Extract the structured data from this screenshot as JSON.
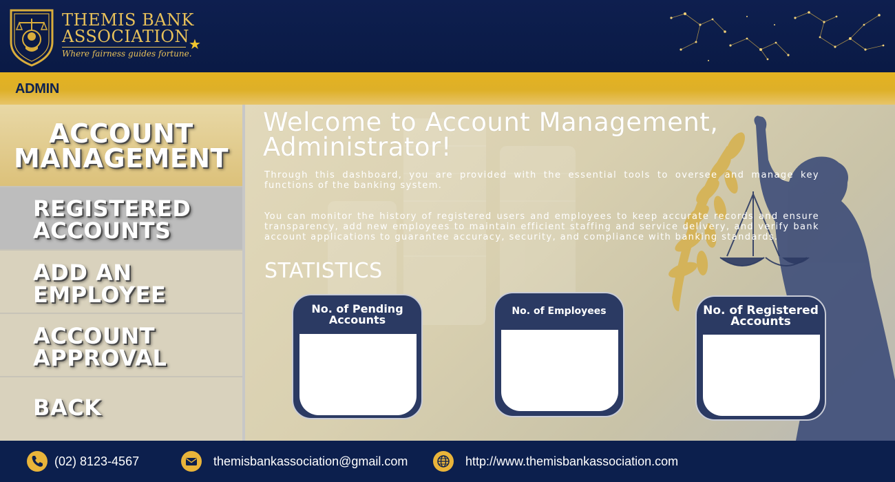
{
  "header": {
    "brand_line1": "THEMIS BANK",
    "brand_line2": "ASSOCIATION",
    "tagline": "Where fairness guides fortune."
  },
  "admin_bar": {
    "label": "ADMIN"
  },
  "sidebar": {
    "items": [
      {
        "label": "ACCOUNT\nMANAGEMENT",
        "active": true
      },
      {
        "label": "REGISTERED\nACCOUNTS"
      },
      {
        "label": "ADD AN\nEMPLOYEE"
      },
      {
        "label": "ACCOUNT\nAPPROVAL"
      },
      {
        "label": "BACK"
      }
    ]
  },
  "main": {
    "title": "Welcome to Account Management, Administrator!",
    "intro_1": "Through this dashboard, you are provided with the essential tools to oversee and manage key functions of the banking system.",
    "intro_2": "You can monitor the history of registered users and employees to keep accurate records and ensure transparency, add new employees to maintain efficient staffing and service delivery, and verify bank account applications to guarantee accuracy, security, and compliance with banking standards.",
    "stats_heading": "STATISTICS",
    "stats": [
      {
        "title": "No. of Pending Accounts",
        "value": ""
      },
      {
        "title": "No. of Employees",
        "value": ""
      },
      {
        "title": "No. of Registered Accounts",
        "value": ""
      }
    ]
  },
  "footer": {
    "phone": "(02) 8123-4567",
    "email": "themisbankassociation@gmail.com",
    "website": "http://www.themisbankassociation.com"
  },
  "colors": {
    "navy": "#0e1f4f",
    "gold": "#e4b221",
    "card": "#2b3a63"
  },
  "icons": [
    "justice-badge-icon",
    "star-icon",
    "constellation-icon",
    "phone-icon",
    "mail-icon",
    "globe-icon"
  ]
}
